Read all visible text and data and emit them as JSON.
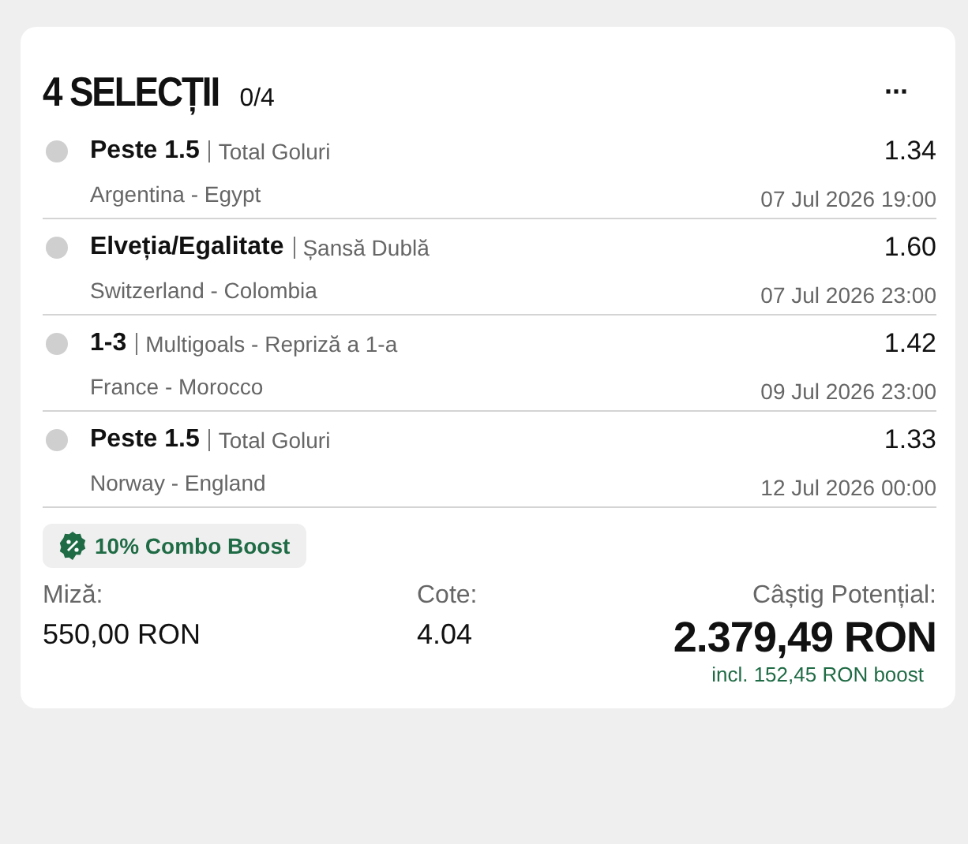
{
  "header": {
    "title": "4 SELECȚII",
    "progress": "0/4",
    "menu": "···"
  },
  "selections": [
    {
      "pick": "Peste 1.5",
      "market": "Total Goluri",
      "odds": "1.34",
      "match": "Argentina - Egypt",
      "date": "07 Jul 2026 19:00"
    },
    {
      "pick": "Elveția/Egalitate",
      "market": "Șansă Dublă",
      "odds": "1.60",
      "match": "Switzerland - Colombia",
      "date": "07 Jul 2026 23:00"
    },
    {
      "pick": "1-3",
      "market": "Multigoals - Repriză a 1-a",
      "odds": "1.42",
      "match": "France - Morocco",
      "date": "09 Jul 2026 23:00"
    },
    {
      "pick": "Peste 1.5",
      "market": "Total Goluri",
      "odds": "1.33",
      "match": "Norway - England",
      "date": "12 Jul 2026 00:00"
    }
  ],
  "boost": {
    "label": "10% Combo Boost"
  },
  "summary": {
    "stake_label": "Miză:",
    "stake": "550,00 RON",
    "odds_label": "Cote:",
    "odds": "4.04",
    "win_label": "Câștig Potențial:",
    "win": "2.379,49 RON",
    "boost_note": "incl. 152,45 RON boost"
  }
}
